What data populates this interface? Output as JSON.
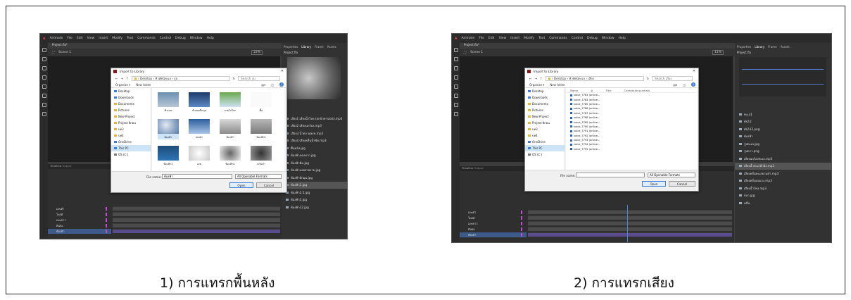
{
  "captions": {
    "left": "1) การแทรกพื้นหลัง",
    "right": "2) การแทรกเสียง"
  },
  "animate": {
    "menu": [
      "Animate",
      "File",
      "Edit",
      "View",
      "Insert",
      "Modify",
      "Text",
      "Commands",
      "Control",
      "Debug",
      "Window",
      "Help"
    ],
    "doc_tab": "Project.fla*",
    "scene": "Scene 1",
    "zoom_left": "22%",
    "zoom_right": "11%",
    "library_tabs": [
      "Properties",
      "Library",
      "Frame",
      "Assets"
    ],
    "library_project": "Project.fla",
    "timeline_tabs": [
      "Timeline",
      "Output"
    ],
    "layers": [
      "เมฆดำ",
      "โพสต์",
      "เมฆขาว",
      "ดินจอ",
      "ท้องฟ้า"
    ]
  },
  "dialog_left": {
    "title": "Import to Library",
    "path": [
      "Desktop",
      "ทิวทัศน์ทะเล",
      "รูป"
    ],
    "search_placeholder": "Search รูป",
    "organize": "Organize ▾",
    "new_folder": "New folder",
    "nav": [
      "Desktop",
      "Downloads",
      "Documents",
      "Pictures",
      "New Project",
      "Project ฝึกฝน",
      "บท3",
      "บท4",
      "OneDrive",
      "This PC",
      "OS (C:)"
    ],
    "tiles": [
      "ฟ้าเมฆ",
      "ฟ้าเมฆอีกมุม",
      "ลายไปโลก",
      "พื้น",
      "ท้องฟ้า",
      "เมฆดำ",
      "ท้องฟ้า",
      "ท้องฟ้า2",
      "ท้องฟ้า3",
      "เมฆ",
      "ท้องฟ้า4",
      "ควันดำ"
    ],
    "filename_label": "File name:",
    "filename_value": "ท้องฟ้า",
    "filter": "All Openable Formats",
    "open": "Open",
    "cancel": "Cancel"
  },
  "dialog_right": {
    "title": "Import to Library",
    "path": [
      "Desktop",
      "ทิวทัศน์ทะเล",
      "เสียง"
    ],
    "search_placeholder": "Search เสียง",
    "organize": "Organize ▾",
    "new_folder": "New folder",
    "nav": [
      "Desktop",
      "Downloads",
      "Documents",
      "Pictures",
      "New Project",
      "Project ฝึกฝน",
      "บท3",
      "บท4",
      "OneDrive",
      "This PC",
      "OS (C:)"
    ],
    "columns": [
      "Name",
      "#",
      "Title",
      "Contributing artists"
    ],
    "files": [
      "voice_7783 (online...",
      "voice_7784 (online...",
      "voice_7785 (online...",
      "voice_7786 (online...",
      "voice_7787 (online...",
      "voice_7788 (online...",
      "voice_7789 (online...",
      "voice_7790 (online...",
      "voice_7791 (online...",
      "voice_7792 (online...",
      "voice_7793 (online...",
      "voice_7794 (online...",
      "voice_7795 (online..."
    ],
    "filename_label": "File name:",
    "filename_value": "",
    "filter": "All Openable Formats",
    "open": "Open",
    "cancel": "Cancel"
  },
  "library_left": [
    "เสียง1 เสียงน้ำไหล (online-tools).mp3",
    "เสียง2 เสียงนกร้อง.mp3",
    "เสียง3 น้ำตก wave.mp3",
    "เสียง4 เสียงคลื่นน้ำซัด.mp3",
    "พื้นหลัง.jpg",
    "ท้องฟ้าแดงมาก.jpg",
    "ท้องฟ้ามืด.jpg",
    "ท้องฟ้าเมฆสวยงาม.jpg",
    "ท้องฟ้าอีกมุม.jpg",
    "ท้องฟ้า1.jpg",
    "ท้องฟ้า2.5.jpg",
    "ท้องฟ้า3.jpg",
    "ท้องฟ้า12.jpg"
  ],
  "library_right": [
    "ทะเล1",
    "ต้นไม้",
    "ต้นไม้2.png",
    "ท้องฟ้า",
    "รูปทะเล.jpg",
    "รูปดาว.png",
    "เสียงนกร้องทะเล.mp3",
    "เสียงน้ำทะเลอีกฝั่ง.mp3",
    "เสียงคลื่นทะเลยามค่ำ.mp3",
    "เสียงคลื่นลมแรง.mp3",
    "เสียงน้ำไหล.mp3",
    "ปลา.jpg",
    "คลื่น"
  ]
}
